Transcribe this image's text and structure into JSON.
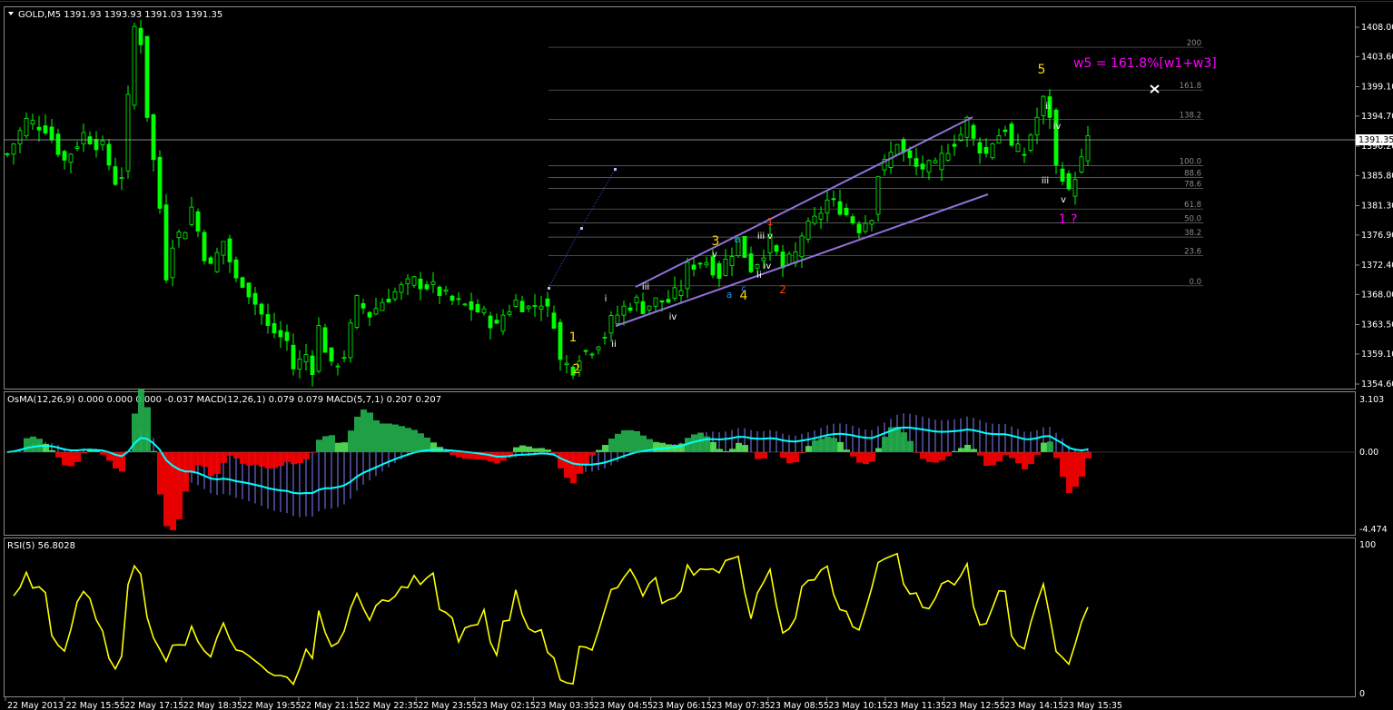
{
  "main_header": "GOLD,M5  1391.93 1393.93 1391.03 1391.35",
  "osma_header": "OsMA(12,26,9) 0.000 0.000 0.000 -0.037  MACD(12,26,1) 0.079 0.079  MACD(5,7,1) 0.207 0.207",
  "rsi_header": "RSI(5) 56.8028",
  "price_tag": "1391.35",
  "annotation": "w5 = 161.8%[w1+w3]",
  "colors": {
    "background": "#000000",
    "candles": "#00ff00",
    "grid": "#808080",
    "channel": "#9370db",
    "rsi": "#ffff00",
    "osma_pos_strong": "#22b14c",
    "osma_pos_weak": "#58e858",
    "osma_neg": "#ff0000",
    "macd_hist": "#8080ff",
    "macd_signal": "#00ffff",
    "wave_gold": "#ffd700",
    "wave_magenta": "#ff00ff",
    "wave_orange": "#ff4500",
    "wave_blue": "#1e90ff"
  },
  "chart_data": [
    {
      "type": "candlestick",
      "title": "GOLD,M5",
      "ohlc_last": {
        "open": 1391.93,
        "high": 1393.93,
        "low": 1391.03,
        "close": 1391.35
      },
      "y_ticks": [
        "1408.00",
        "1403.60",
        "1399.10",
        "1394.70",
        "1390.20",
        "1385.80",
        "1381.30",
        "1376.90",
        "1372.40",
        "1368.00",
        "1363.50",
        "1359.10",
        "1354.60"
      ],
      "ylim": [
        1354.6,
        1410.0
      ],
      "x_ticks": [
        "22 May 2013",
        "22 May 15:55",
        "22 May 17:15",
        "22 May 18:35",
        "22 May 19:55",
        "22 May 21:15",
        "22 May 22:35",
        "22 May 23:55",
        "23 May 02:15",
        "23 May 03:35",
        "23 May 04:55",
        "23 May 06:15",
        "23 May 07:35",
        "23 May 08:55",
        "23 May 10:15",
        "23 May 11:35",
        "23 May 12:55",
        "23 May 14:15",
        "23 May 15:35"
      ],
      "close_path": [
        [
          0,
          1389
        ],
        [
          3,
          1394
        ],
        [
          6,
          1393
        ],
        [
          9,
          1388
        ],
        [
          12,
          1392
        ],
        [
          15,
          1390
        ],
        [
          17,
          1385
        ],
        [
          18,
          1386
        ],
        [
          19,
          1397
        ],
        [
          20,
          1408
        ],
        [
          21,
          1406
        ],
        [
          22,
          1395
        ],
        [
          24,
          1381
        ],
        [
          25,
          1371
        ],
        [
          26,
          1376
        ],
        [
          28,
          1378
        ],
        [
          29,
          1381
        ],
        [
          31,
          1374
        ],
        [
          32,
          1372
        ],
        [
          34,
          1376
        ],
        [
          35,
          1373
        ],
        [
          36,
          1370
        ],
        [
          37,
          1370
        ],
        [
          40,
          1365
        ],
        [
          41,
          1363
        ],
        [
          44,
          1361
        ],
        [
          45,
          1357
        ],
        [
          46,
          1358
        ],
        [
          47,
          1359
        ],
        [
          48,
          1357
        ],
        [
          49,
          1363
        ],
        [
          50,
          1360
        ],
        [
          51,
          1357
        ],
        [
          53,
          1359
        ],
        [
          54,
          1363
        ],
        [
          55,
          1367
        ],
        [
          57,
          1365
        ],
        [
          59,
          1367
        ],
        [
          62,
          1369
        ],
        [
          64,
          1370
        ],
        [
          67,
          1369
        ],
        [
          70,
          1367
        ],
        [
          73,
          1366
        ],
        [
          75,
          1365
        ],
        [
          77,
          1363
        ],
        [
          78,
          1365
        ],
        [
          80,
          1367
        ],
        [
          82,
          1366
        ],
        [
          84,
          1367
        ],
        [
          86,
          1364
        ],
        [
          87,
          1358
        ],
        [
          89,
          1357
        ],
        [
          90,
          1359
        ],
        [
          92,
          1360
        ],
        [
          94,
          1362
        ],
        [
          95,
          1364
        ],
        [
          97,
          1366
        ],
        [
          99,
          1367
        ],
        [
          100,
          1366
        ],
        [
          102,
          1367
        ],
        [
          104,
          1367
        ],
        [
          106,
          1369
        ],
        [
          107,
          1372
        ],
        [
          109,
          1373
        ],
        [
          110,
          1373
        ],
        [
          112,
          1371
        ],
        [
          113,
          1373
        ],
        [
          115,
          1376
        ],
        [
          116,
          1374
        ],
        [
          117,
          1372
        ],
        [
          118,
          1373
        ],
        [
          120,
          1376
        ],
        [
          121,
          1374
        ],
        [
          122,
          1372
        ],
        [
          124,
          1374
        ],
        [
          125,
          1377
        ],
        [
          127,
          1379
        ],
        [
          129,
          1382
        ],
        [
          131,
          1381
        ],
        [
          133,
          1379
        ],
        [
          134,
          1378
        ],
        [
          136,
          1380
        ],
        [
          137,
          1386
        ],
        [
          139,
          1389
        ],
        [
          140,
          1391
        ],
        [
          141,
          1389
        ],
        [
          143,
          1387
        ],
        [
          146,
          1387
        ],
        [
          148,
          1390
        ],
        [
          150,
          1392
        ],
        [
          151,
          1394
        ],
        [
          152,
          1391
        ],
        [
          154,
          1389
        ],
        [
          155,
          1391
        ],
        [
          157,
          1393
        ],
        [
          158,
          1390
        ],
        [
          160,
          1389
        ],
        [
          161,
          1392
        ],
        [
          163,
          1397
        ],
        [
          164,
          1395
        ],
        [
          165,
          1387
        ],
        [
          166,
          1386
        ],
        [
          167,
          1383
        ],
        [
          168,
          1386
        ],
        [
          169,
          1388
        ],
        [
          170,
          1391
        ]
      ],
      "horizontal_line": 1391.35,
      "fibonacci_levels": [
        "200",
        "161.8",
        "138.2",
        "100.0",
        "88.6",
        "78.6",
        "61.8",
        "50.0",
        "38.2",
        "23.6",
        "0.0"
      ],
      "wave_labels": [
        "1",
        "2",
        "3",
        "4",
        "5",
        "i",
        "ii",
        "iii",
        "iv",
        "v",
        "a",
        "b",
        "c",
        "1 ?"
      ],
      "annotation": "w5 = 161.8%[w1+w3]"
    },
    {
      "type": "histogram",
      "title": "OsMA(12,26,9)",
      "series": [
        {
          "name": "OsMA(12,26,9)",
          "values": [
            0.0,
            0.0,
            0.0,
            -0.037
          ]
        },
        {
          "name": "MACD(12,26,1)",
          "values": [
            0.079,
            0.079
          ]
        },
        {
          "name": "MACD(5,7,1)",
          "values": [
            0.207,
            0.207
          ]
        }
      ],
      "y_ticks": [
        "3.103",
        "0.00",
        "-4.474"
      ],
      "ylim": [
        -4.474,
        3.103
      ]
    },
    {
      "type": "line",
      "title": "RSI(5)",
      "series": [
        {
          "name": "RSI(5)",
          "values": [
            56.8028
          ]
        }
      ],
      "y_ticks": [
        "100",
        "0"
      ],
      "ylim": [
        0,
        100
      ]
    }
  ]
}
